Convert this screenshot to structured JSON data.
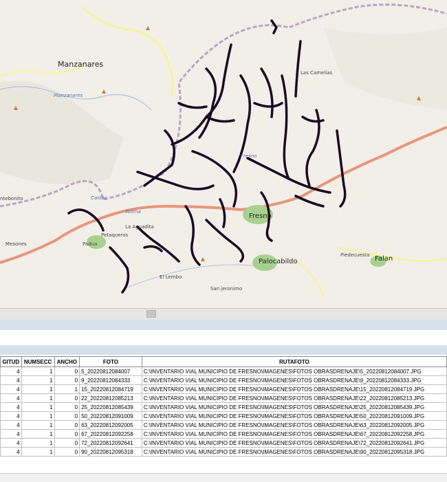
{
  "map": {
    "labels": {
      "manzanares": "Manzanares",
      "manzanares_river": "Manzanares",
      "las_camelias": "Las Camelias",
      "fresno_area": "Fresno",
      "fresno_town": "Fresno",
      "petaqueros": "Petaqueros",
      "la_aguadita": "La Aguadita",
      "padua": "Padua",
      "mesones": "Mesones",
      "ntebonito": "ntebonito",
      "palocabildo": "Palocabildo",
      "piedecuesta": "Piedecuesta",
      "falan": "Falan",
      "el_lembo": "El Lembo",
      "san_jeronimo": "San jeronimo",
      "tolima": "Tolima",
      "caldas": "Caldas"
    },
    "colors": {
      "background": "#f2efe9",
      "roads_layer": "#1a0a24",
      "main_road": "#e8957a",
      "secondary_road": "#f6f49a",
      "dept_border": "#b8a3c8",
      "urban": "#a9d18e"
    }
  },
  "table": {
    "columns": [
      "GITUD",
      "NUMSECC",
      "ANCHO",
      "FOTO",
      "RUTAFOTO"
    ],
    "rows": [
      [
        "4",
        "1",
        "0",
        "5_20220812084007",
        "C:\\INVENTARIO VIAL MUNICIPIO DE FRESNO\\IMAGENES\\FOTOS OBRASDRENAJE\\5_20220812084007.JPG"
      ],
      [
        "4",
        "1",
        "0",
        "9_20220812084333",
        "C:\\INVENTARIO VIAL MUNICIPIO DE FRESNO\\IMAGENES\\FOTOS OBRASDRENAJE\\9_20220812084333.JPG"
      ],
      [
        "4",
        "1",
        "1",
        "15_20220812084719",
        "C:\\INVENTARIO VIAL MUNICIPIO DE FRESNO\\IMAGENES\\FOTOS OBRASDRENAJE\\15_20220812084719.JPG"
      ],
      [
        "4",
        "1",
        "0",
        "22_20220812085213",
        "C:\\INVENTARIO VIAL MUNICIPIO DE FRESNO\\IMAGENES\\FOTOS OBRASDRENAJE\\22_20220812085213.JPG"
      ],
      [
        "4",
        "1",
        "0",
        "25_20220812085439",
        "C:\\INVENTARIO VIAL MUNICIPIO DE FRESNO\\IMAGENES\\FOTOS OBRASDRENAJE\\25_20220812085439.JPG"
      ],
      [
        "4",
        "1",
        "0",
        "50_20220812091009",
        "C:\\INVENTARIO VIAL MUNICIPIO DE FRESNO\\IMAGENES\\FOTOS OBRASDRENAJE\\50_20220812091009.JPG"
      ],
      [
        "4",
        "1",
        "0",
        "63_20220812092005",
        "C:\\INVENTARIO VIAL MUNICIPIO DE FRESNO\\IMAGENES\\FOTOS OBRASDRENAJE\\63_20220812092005.JPG"
      ],
      [
        "4",
        "1",
        "0",
        "67_20220812092258",
        "C:\\INVENTARIO VIAL MUNICIPIO DE FRESNO\\IMAGENES\\FOTOS OBRASDRENAJE\\67_20220812092258.JPG"
      ],
      [
        "4",
        "1",
        "0",
        "72_20220812092641",
        "C:\\INVENTARIO VIAL MUNICIPIO DE FRESNO\\IMAGENES\\FOTOS OBRASDRENAJE\\72_20220812092641.JPG"
      ],
      [
        "4",
        "1",
        "0",
        "90_20220812095318",
        "C:\\INVENTARIO VIAL MUNICIPIO DE FRESNO\\IMAGENES\\FOTOS OBRASDRENAJE\\90_20220812095318.JPG"
      ]
    ]
  }
}
